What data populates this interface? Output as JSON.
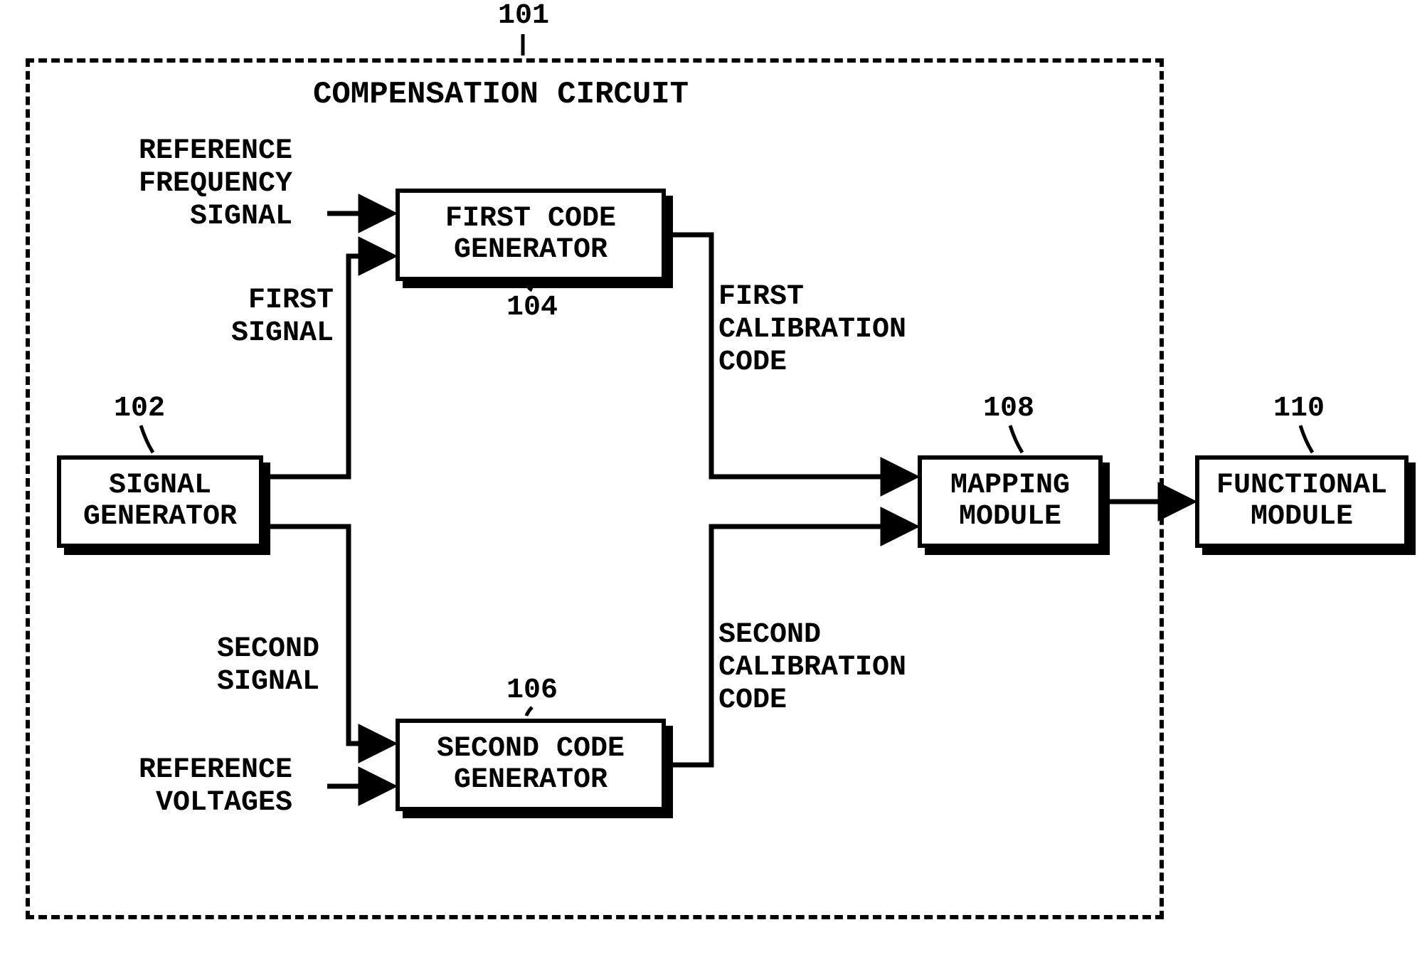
{
  "diagram_title": "COMPENSATION CIRCUIT",
  "outer_ref": "101",
  "blocks": {
    "signal_generator": {
      "label": "SIGNAL\nGENERATOR",
      "ref": "102"
    },
    "first_code_gen": {
      "label": "FIRST CODE\nGENERATOR",
      "ref": "104"
    },
    "second_code_gen": {
      "label": "SECOND CODE\nGENERATOR",
      "ref": "106"
    },
    "mapping_module": {
      "label": "MAPPING\nMODULE",
      "ref": "108"
    },
    "functional_module": {
      "label": "FUNCTIONAL\nMODULE",
      "ref": "110"
    }
  },
  "signals": {
    "ref_freq": "REFERENCE\nFREQUENCY\nSIGNAL",
    "ref_volt": "REFERENCE\nVOLTAGES",
    "first_signal": "FIRST\nSIGNAL",
    "second_signal": "SECOND\nSIGNAL",
    "first_cal": "FIRST\nCALIBRATION\nCODE",
    "second_cal": "SECOND\nCALIBRATION\nCODE"
  }
}
